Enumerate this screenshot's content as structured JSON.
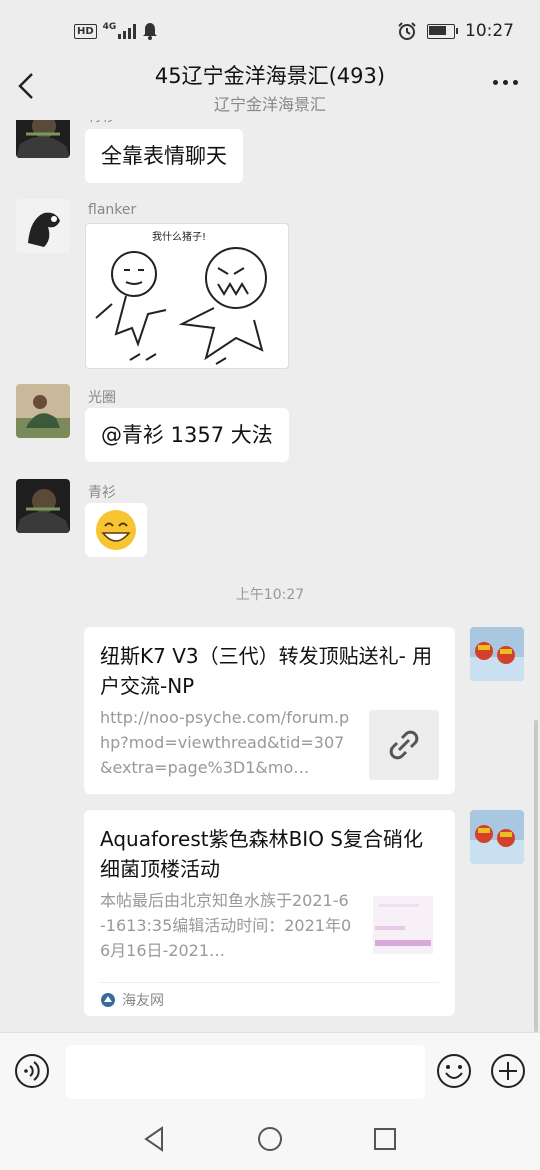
{
  "status_bar": {
    "network_badge": "HD",
    "network_type": "4G",
    "alarm_icon": "alarm-icon",
    "battery_icon": "battery-icon",
    "battery_level": 0.75,
    "time": "10:27"
  },
  "header": {
    "title": "45辽宁金洋海景汇(493)",
    "subtitle": "辽宁金洋海景汇",
    "back_icon": "chevron-left-icon",
    "more_icon": "more-dots-icon"
  },
  "messages": [
    {
      "sender": "青衫",
      "text": "全靠表情聊天"
    },
    {
      "sender": "flanker",
      "sticker_caption": "我什么猪子!"
    },
    {
      "sender": "光圈",
      "text": "@青衫  1357 大法"
    },
    {
      "sender": "青衫",
      "emoji": "😄"
    }
  ],
  "timestamp": "上午10:27",
  "link_cards": [
    {
      "title": "纽斯K7 V3（三代）转发顶贴送礼- 用户交流-NP",
      "desc": "http://noo-psyche.com/forum.php?mod=viewthread&tid=307&extra=page%3D1&mo…",
      "thumb_icon": "link-icon"
    },
    {
      "title": "Aquaforest紫色森林BIO S复合硝化细菌顶楼活动",
      "desc": "本帖最后由北京知鱼水族于2021-6-1613:35编辑活动时间：2021年06月16日-2021…",
      "source": "海友网"
    }
  ],
  "input_bar": {
    "voice_icon": "voice-icon",
    "emoji_icon": "emoji-icon",
    "plus_icon": "plus-icon",
    "placeholder": ""
  },
  "nav_bar": {
    "back_icon": "triangle-back-icon",
    "home_icon": "circle-home-icon",
    "recent_icon": "square-recent-icon"
  },
  "colors": {
    "background": "#ededed",
    "bubble": "#ffffff",
    "meta_text": "#888888"
  }
}
